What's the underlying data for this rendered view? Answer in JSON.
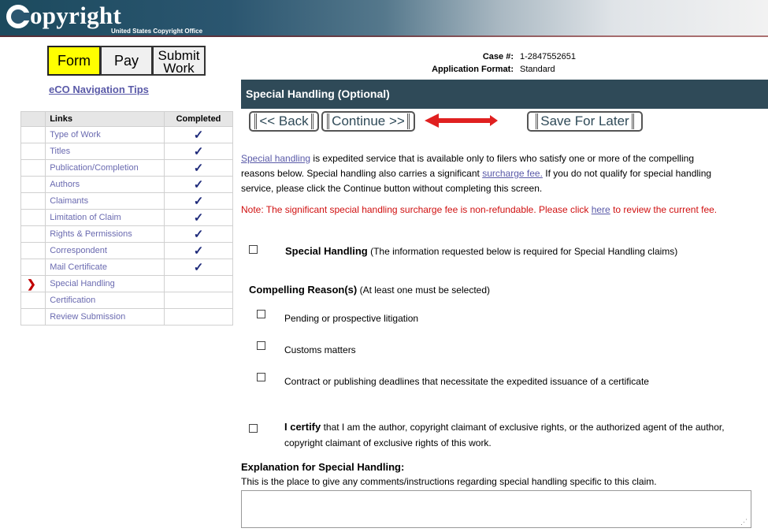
{
  "header": {
    "logo_text": "opyright",
    "logo_subtitle": "United States Copyright Office"
  },
  "steps": {
    "form": "Form",
    "pay": "Pay",
    "submit_line1": "Submit",
    "submit_line2": "Work",
    "active": "Form"
  },
  "nav_tips": "eCO Navigation Tips",
  "links_table": {
    "headers": {
      "links": "Links",
      "completed": "Completed"
    },
    "rows": [
      {
        "label": "Type of Work",
        "completed": true
      },
      {
        "label": "Titles",
        "completed": true
      },
      {
        "label": "Publication/Completion",
        "completed": true
      },
      {
        "label": "Authors",
        "completed": true
      },
      {
        "label": "Claimants",
        "completed": true
      },
      {
        "label": "Limitation of Claim",
        "completed": true
      },
      {
        "label": "Rights & Permissions",
        "completed": true
      },
      {
        "label": "Correspondent",
        "completed": true
      },
      {
        "label": "Mail Certificate",
        "completed": true
      },
      {
        "label": "Special Handling",
        "completed": false,
        "current": true
      },
      {
        "label": "Certification",
        "completed": false
      },
      {
        "label": "Review Submission",
        "completed": false
      }
    ],
    "check_glyph": "✓",
    "current_glyph": "❯"
  },
  "case": {
    "case_label": "Case #:",
    "case_value": "1-2847552651",
    "format_label": "Application Format:",
    "format_value": "Standard"
  },
  "section_title": "Special Handling (Optional)",
  "buttons": {
    "back": "<< Back",
    "continue": "Continue >>",
    "save": "Save For Later"
  },
  "intro": {
    "link1": "Special handling",
    "text1": " is expedited service that is available only to filers who satisfy one or more of the compelling reasons below. Special handling also carries a significant ",
    "link2": "surcharge fee.",
    "text2": " If you do not qualify for special handling service, please click the Continue button without completing this screen."
  },
  "note": {
    "text1": "Note: The significant special handling surcharge fee is non-refundable. Please click ",
    "link": "here",
    "text2": " to review the current fee."
  },
  "special_handling": {
    "label": "Special Handling",
    "desc": " (The information requested below is required for Special Handling claims)",
    "checked": false
  },
  "compelling": {
    "title": "Compelling Reason(s)",
    "hint": " (At least one must be selected)",
    "options": [
      {
        "label": "Pending or prospective litigation",
        "checked": false
      },
      {
        "label": "Customs matters",
        "checked": false
      },
      {
        "label": "Contract or publishing deadlines that necessitate the expedited issuance of a certificate",
        "checked": false
      }
    ]
  },
  "certify": {
    "bold": "I certify",
    "line1": " that I am the author, copyright claimant of exclusive rights, or the authorized agent of the author,",
    "line2": "copyright claimant of exclusive rights of this work.",
    "checked": false
  },
  "explanation": {
    "title": "Explanation for Special Handling:",
    "help": "This is the place to give any comments/instructions regarding special handling specific to this claim.",
    "value": ""
  },
  "colors": {
    "header_bar": "#2f4a58",
    "active_tab": "#ffff00",
    "note_red": "#d01010",
    "link": "#5a5aa8",
    "arrow": "#e02020"
  }
}
